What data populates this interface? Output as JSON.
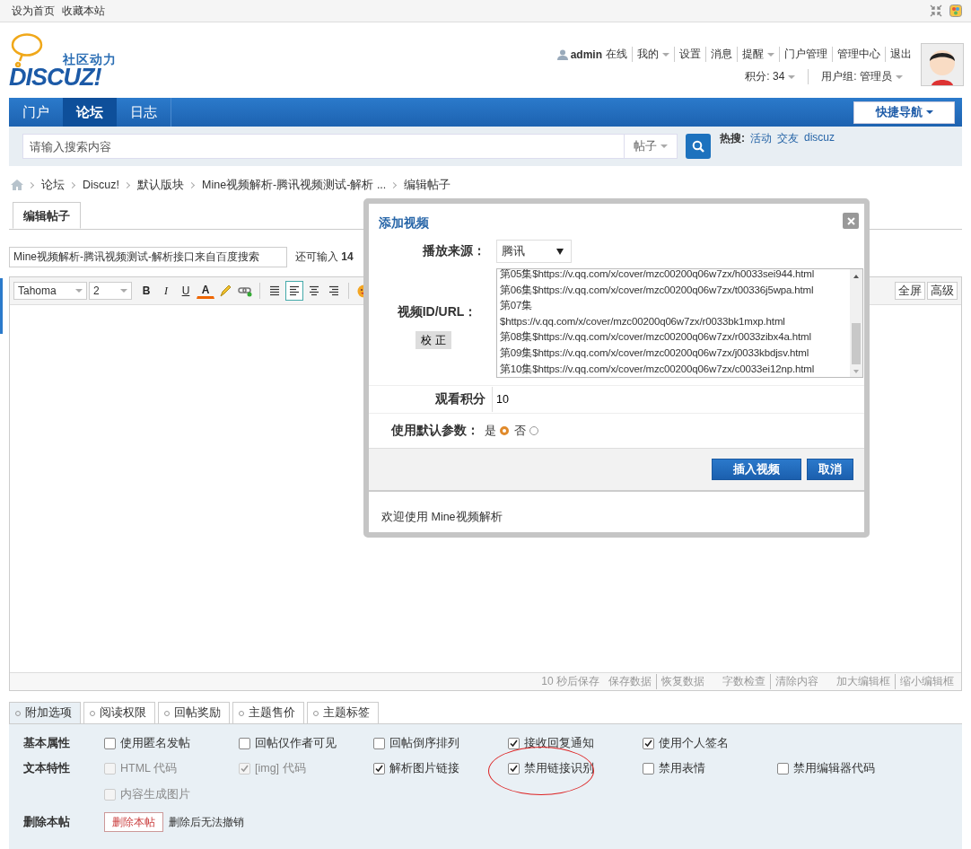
{
  "topbar": {
    "links": [
      "设为首页",
      "收藏本站"
    ]
  },
  "logo": {
    "tagline": "社区动力",
    "wordmark": "DISCUZ!"
  },
  "user": {
    "name": "admin",
    "status": "在线",
    "menu": [
      {
        "label": "我的",
        "dropdown": true
      },
      {
        "label": "设置",
        "dropdown": false
      },
      {
        "label": "消息",
        "dropdown": false
      },
      {
        "label": "提醒",
        "dropdown": true
      },
      {
        "label": "门户管理",
        "dropdown": false
      },
      {
        "label": "管理中心",
        "dropdown": false
      },
      {
        "label": "退出",
        "dropdown": false
      }
    ],
    "points": "积分: 34",
    "group": "用户组: 管理员"
  },
  "nav": {
    "items": [
      {
        "label": "门户",
        "selected": false
      },
      {
        "label": "论坛",
        "selected": true
      },
      {
        "label": "日志",
        "selected": false
      }
    ],
    "quick_nav": "快捷导航"
  },
  "search": {
    "placeholder": "请输入搜索内容",
    "scope": "帖子",
    "hot_label": "热搜:",
    "hot": [
      "活动",
      "交友",
      "discuz"
    ]
  },
  "breadcrumb": [
    "论坛",
    "Discuz!",
    "默认版块",
    "Mine视频解析-腾讯视频测试-解析 ...",
    "编辑帖子"
  ],
  "page_tab": "编辑帖子",
  "title_field": {
    "value": "Mine视频解析-腾讯视频测试-解析接口来自百度搜索",
    "remaining": "还可输入 **14**"
  },
  "editor": {
    "font": "Tahoma",
    "size": "2",
    "tools": [
      {
        "kind": "bold",
        "label": "B"
      },
      {
        "kind": "italic",
        "label": "I"
      },
      {
        "kind": "underline",
        "label": "U"
      },
      {
        "kind": "color",
        "label": "A"
      },
      {
        "kind": "spell"
      },
      {
        "kind": "link"
      },
      {
        "kind": "sep"
      },
      {
        "kind": "align-justify",
        "selected": false
      },
      {
        "kind": "align-left",
        "selected": true
      },
      {
        "kind": "align-center",
        "selected": false
      },
      {
        "kind": "align-right",
        "selected": false
      },
      {
        "kind": "sep"
      },
      {
        "kind": "emoji"
      }
    ],
    "right_buttons": [
      "全屏",
      "高级"
    ],
    "autosave": "10 秒后保存",
    "links": [
      {
        "label": "保存数据",
        "divider": true
      },
      {
        "label": "恢复数据",
        "divider": false
      },
      {
        "label": "字数检查",
        "divider": true
      },
      {
        "label": "清除内容",
        "divider": false
      },
      {
        "label": "加大编辑框",
        "divider": true
      },
      {
        "label": "缩小编辑框",
        "divider": false
      }
    ]
  },
  "options": {
    "tabs": [
      {
        "label": "附加选项",
        "selected": true
      },
      {
        "label": "阅读权限",
        "selected": false
      },
      {
        "label": "回帖奖励",
        "selected": false
      },
      {
        "label": "主题售价",
        "selected": false
      },
      {
        "label": "主题标签",
        "selected": false
      }
    ],
    "groups": [
      {
        "label": "基本属性",
        "items": [
          {
            "label": "使用匿名发帖",
            "checked": false,
            "disabled": false,
            "circled": false
          },
          {
            "label": "回帖仅作者可见",
            "checked": false,
            "disabled": false,
            "circled": false
          },
          {
            "label": "回帖倒序排列",
            "checked": false,
            "disabled": false,
            "circled": false
          },
          {
            "label": "接收回复通知",
            "checked": true,
            "disabled": false,
            "circled": false
          },
          {
            "label": "使用个人签名",
            "checked": true,
            "disabled": false,
            "circled": false
          }
        ]
      },
      {
        "label": "文本特性",
        "items": [
          {
            "label": "HTML 代码",
            "checked": false,
            "disabled": true,
            "circled": false
          },
          {
            "label": "[img] 代码",
            "checked": true,
            "disabled": true,
            "circled": false
          },
          {
            "label": "解析图片链接",
            "checked": true,
            "disabled": false,
            "circled": false
          },
          {
            "label": "禁用链接识别",
            "checked": true,
            "disabled": false,
            "circled": true
          },
          {
            "label": "禁用表情",
            "checked": false,
            "disabled": false,
            "circled": false
          },
          {
            "label": "禁用编辑器代码",
            "checked": false,
            "disabled": false,
            "circled": false
          },
          {
            "label": "内容生成图片",
            "checked": false,
            "disabled": true,
            "circled": false
          }
        ]
      }
    ],
    "delete": {
      "label": "删除本帖",
      "button": "删除本帖",
      "note": "删除后无法撤销"
    }
  },
  "dialog": {
    "title": "添加视频",
    "source_label": "播放来源：",
    "source": "腾讯",
    "url_label": "视频ID/URL：",
    "fix_button": "校 正",
    "url_lines": [
      "第05集$https://v.qq.com/x/cover/mzc00200q06w7zx/h0033sei944.html",
      "第06集$https://v.qq.com/x/cover/mzc00200q06w7zx/t00336j5wpa.html",
      "第07集",
      "$https://v.qq.com/x/cover/mzc00200q06w7zx/r0033bk1mxp.html",
      "第08集$https://v.qq.com/x/cover/mzc00200q06w7zx/r0033zibx4a.html",
      "第09集$https://v.qq.com/x/cover/mzc00200q06w7zx/j0033kbdjsv.html",
      "第10集$https://v.qq.com/x/cover/mzc00200q06w7zx/c0033ei12np.html"
    ],
    "points_label": "观看积分",
    "points": "10",
    "default_label": "使用默认参数：",
    "default_options": [
      {
        "label": "是",
        "selected": true
      },
      {
        "label": "否",
        "selected": false
      }
    ],
    "insert_button": "插入视频",
    "cancel_button": "取消",
    "footer": "欢迎使用 Mine视频解析"
  }
}
